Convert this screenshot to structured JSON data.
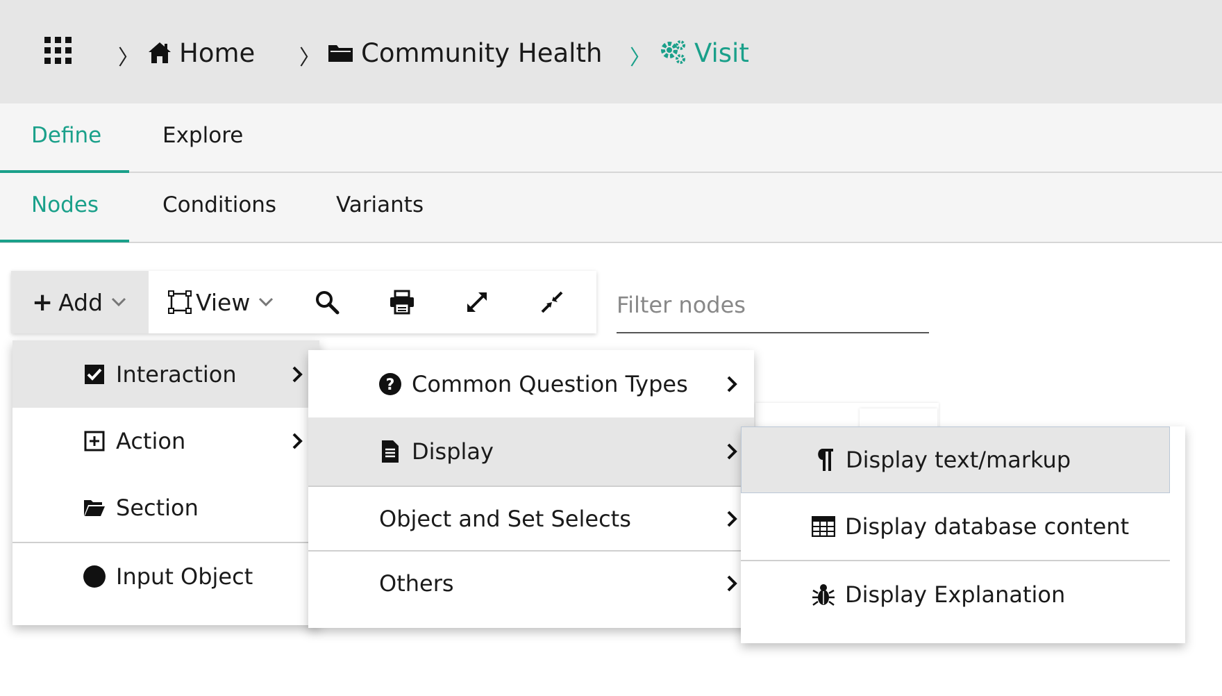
{
  "breadcrumb": {
    "apps_icon": "grid-icon",
    "items": [
      {
        "label": "Home",
        "icon": "home-icon"
      },
      {
        "label": "Community Health",
        "icon": "folder-icon"
      },
      {
        "label": "Visit",
        "icon": "gears-icon",
        "active": true
      }
    ]
  },
  "tabs_primary": [
    {
      "label": "Define",
      "active": true
    },
    {
      "label": "Explore"
    }
  ],
  "tabs_secondary": [
    {
      "label": "Nodes",
      "active": true
    },
    {
      "label": "Conditions"
    },
    {
      "label": "Variants"
    }
  ],
  "toolbar": {
    "add_label": "Add",
    "view_label": "View",
    "icons": [
      "search-icon",
      "print-icon",
      "expand-icon",
      "compress-icon"
    ]
  },
  "filter": {
    "placeholder": "Filter nodes",
    "value": ""
  },
  "menu_level1": [
    {
      "label": "Interaction",
      "icon": "checkbox-checked-icon",
      "submenu": true,
      "highlighted": true
    },
    {
      "label": "Action",
      "icon": "plus-square-icon",
      "submenu": true
    },
    {
      "label": "Section",
      "icon": "folder-open-icon"
    },
    {
      "label": "Input Object",
      "icon": "circle-icon"
    }
  ],
  "menu_level2": [
    {
      "label": "Common Question Types",
      "icon": "question-circle-icon",
      "submenu": true
    },
    {
      "label": "Display",
      "icon": "document-icon",
      "submenu": true,
      "highlighted": true
    },
    {
      "label": "Object and Set Selects",
      "submenu": true
    },
    {
      "label": "Others",
      "submenu": true
    }
  ],
  "menu_level3": [
    {
      "label": "Display text/markup",
      "icon": "paragraph-icon",
      "highlighted": true
    },
    {
      "label": "Display database content",
      "icon": "table-icon"
    },
    {
      "label": "Display Explanation",
      "icon": "bug-icon"
    }
  ],
  "colors": {
    "accent": "#1aa08a",
    "highlight": "#e6e6e6",
    "topbar": "#e6e6e6"
  }
}
